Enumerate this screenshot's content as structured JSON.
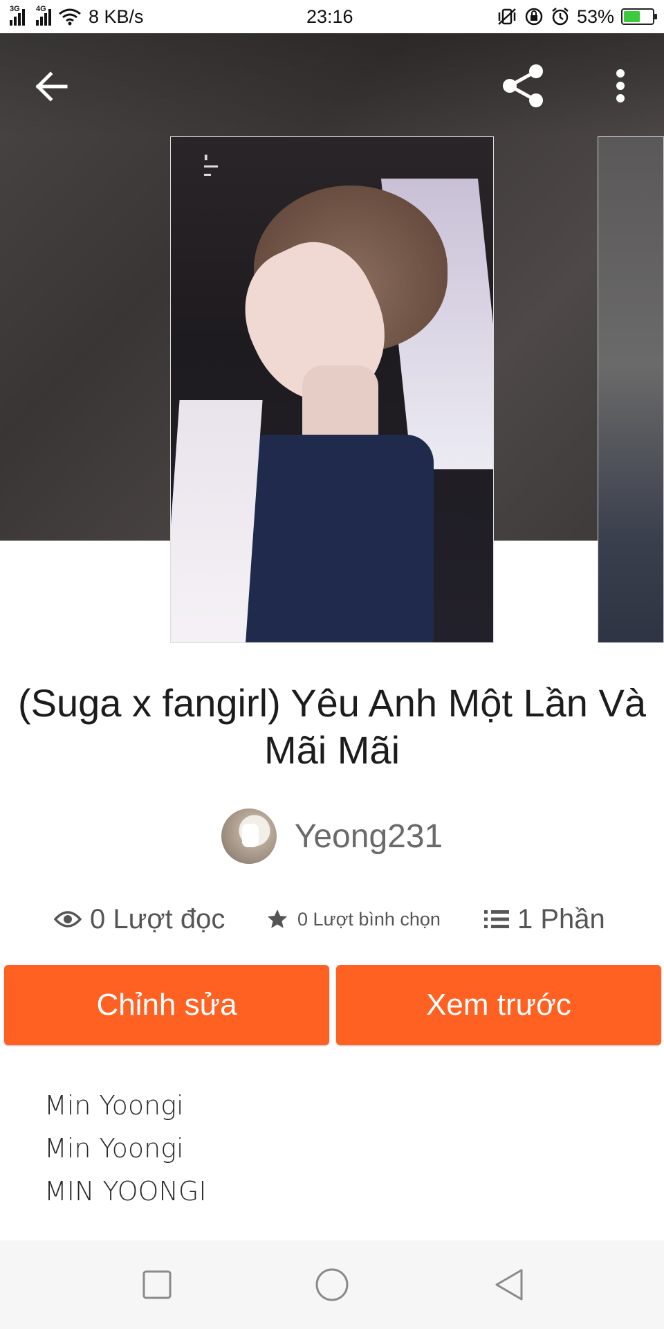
{
  "status_bar": {
    "network_1": "3G",
    "network_2": "4G",
    "speed": "8 KB/s",
    "time": "23:16",
    "battery": "53%"
  },
  "toolbar": {
    "back_icon": "arrow-left-icon",
    "share_icon": "share-icon",
    "more_icon": "more-vertical-icon"
  },
  "story": {
    "title": "(Suga x fangirl) Yêu Anh Một Lần Và Mãi Mãi",
    "author": "Yeong231"
  },
  "stats": {
    "reads": "0 Lượt đọc",
    "votes": "0 Lượt bình chọn",
    "parts": "1 Phần"
  },
  "actions": {
    "edit_label": "Chỉnh sửa",
    "preview_label": "Xem trước"
  },
  "description": {
    "lines": [
      "Min Yoongi",
      "Min Yoongi",
      "MIN YOONGI",
      "..."
    ]
  },
  "colors": {
    "accent": "#ff6122"
  }
}
